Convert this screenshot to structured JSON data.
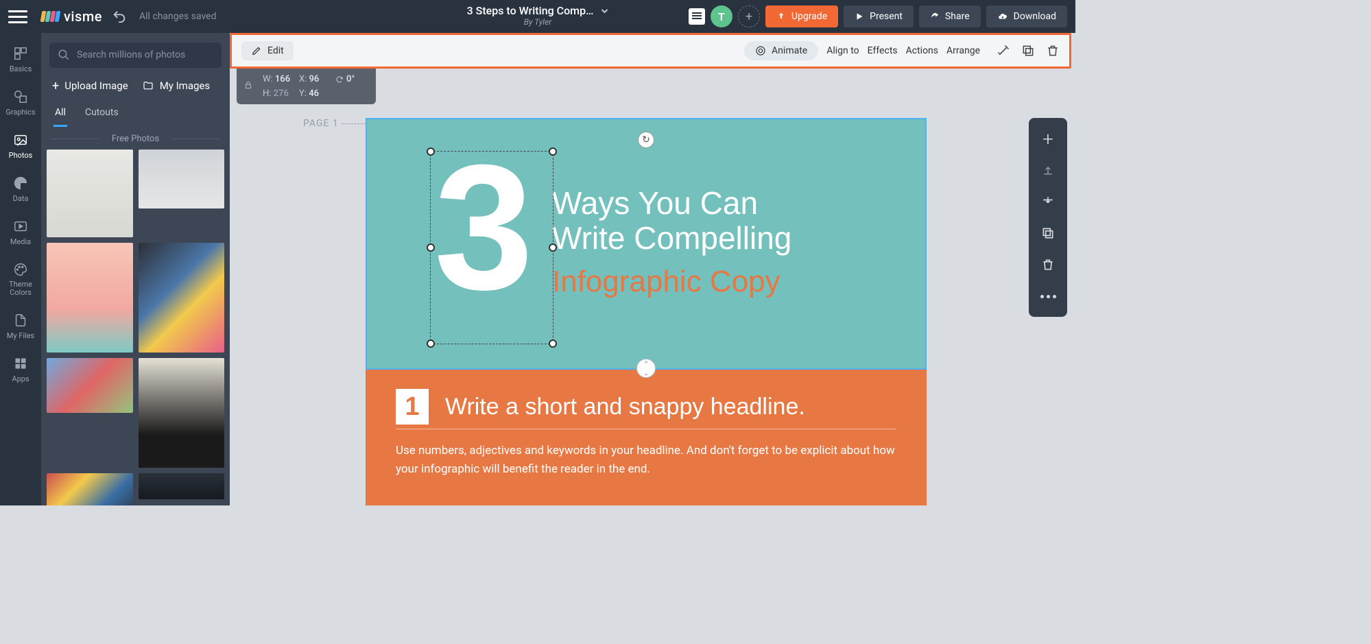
{
  "topbar": {
    "logo_text": "visme",
    "save_status": "All changes saved",
    "doc_title": "3 Steps to Writing Comp…",
    "byline": "By Tyler",
    "avatar_initial": "T",
    "upgrade": "Upgrade",
    "present": "Present",
    "share": "Share",
    "download": "Download"
  },
  "leftbar": {
    "items": [
      "Basics",
      "Graphics",
      "Photos",
      "Data",
      "Media",
      "Theme Colors",
      "My Files",
      "Apps"
    ],
    "active_index": 2
  },
  "panel": {
    "search_placeholder": "Search millions of photos",
    "upload": "Upload Image",
    "my_images": "My Images",
    "tabs": [
      "All",
      "Cutouts"
    ],
    "active_tab": 0,
    "section": "Free Photos"
  },
  "context": {
    "edit": "Edit",
    "animate": "Animate",
    "align_to": "Align to",
    "effects": "Effects",
    "actions": "Actions",
    "arrange": "Arrange"
  },
  "dims": {
    "w_label": "W:",
    "w": "166",
    "h_label": "H:",
    "h": "276",
    "x_label": "X:",
    "x": "96",
    "y_label": "Y:",
    "y": "46",
    "rot": "0°"
  },
  "canvas": {
    "page_label": "PAGE 1",
    "big_number": "3",
    "headline_1": "Ways You Can",
    "headline_2": "Write Compelling",
    "headline_3": "Infographic Copy",
    "step1_num": "1",
    "step1_title": "Write a short and snappy headline.",
    "step1_body": "Use numbers, adjectives and keywords in your headline. And don't forget to be explicit about how your infographic will benefit the reader in the end."
  },
  "colors": {
    "accent": "#f26835",
    "teal": "#73c0bd",
    "orange_body": "#e87843"
  }
}
